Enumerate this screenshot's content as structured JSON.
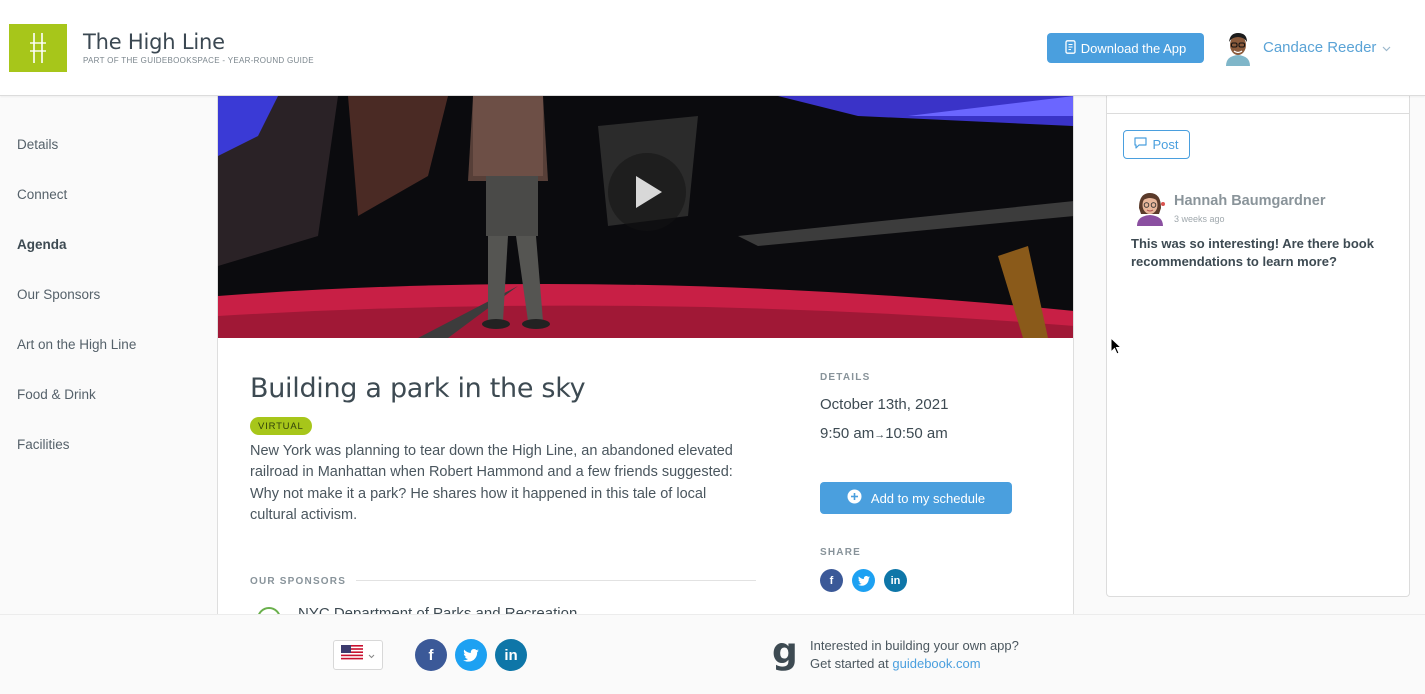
{
  "header": {
    "title": "The High Line",
    "subtitle": "PART OF THE GUIDEBOOKSPACE - YEAR-ROUND GUIDE",
    "download_label": "Download the App",
    "user_name": "Candace Reeder"
  },
  "sidebar": {
    "items": [
      {
        "label": "Details"
      },
      {
        "label": "Connect"
      },
      {
        "label": "Agenda",
        "active": true
      },
      {
        "label": "Our Sponsors"
      },
      {
        "label": "Art on the High Line"
      },
      {
        "label": "Food & Drink"
      },
      {
        "label": "Facilities"
      }
    ]
  },
  "session": {
    "title": "Building a park in the sky",
    "badge": "VIRTUAL",
    "description": "New York was planning to tear down the High Line, an abandoned elevated railroad in Manhattan when Robert Hammond and a few friends suggested: Why not make it a park? He shares how it happened in this tale of local cultural activism.",
    "sponsors_heading": "OUR SPONSORS",
    "sponsor_name": "NYC Department of Parks and Recreation"
  },
  "details": {
    "heading": "DETAILS",
    "date": "October 13th, 2021",
    "start_time": "9:50 am",
    "end_time": "10:50 am",
    "add_label": "Add to my schedule",
    "share_heading": "SHARE"
  },
  "panel": {
    "post_label": "Post",
    "comment": {
      "author": "Hannah Baumgardner",
      "time": "3 weeks ago",
      "text": "This was so interesting! Are there book recommendations to learn more?"
    }
  },
  "footer": {
    "cta_line1": "Interested in building your own app?",
    "cta_prefix": "Get started at",
    "cta_link": "guidebook.com"
  },
  "colors": {
    "brand_green": "#a7c61a",
    "accent_blue": "#4a9fde",
    "facebook": "#3b5998",
    "twitter": "#1da1f2",
    "linkedin": "#0e76a8"
  },
  "icons": [
    "high-line-logo-icon",
    "phone-icon",
    "chevron-down-icon",
    "play-icon",
    "plus-circle-icon",
    "facebook-icon",
    "twitter-icon",
    "linkedin-icon",
    "comment-icon",
    "us-flag-icon",
    "guidebook-logo-icon",
    "cursor-icon"
  ]
}
